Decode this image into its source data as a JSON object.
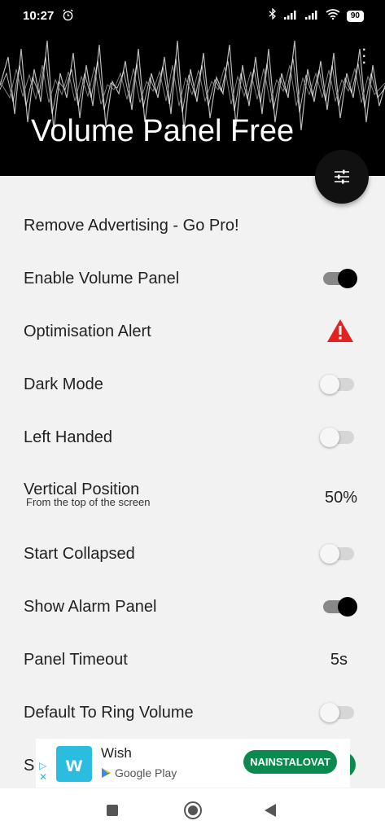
{
  "status": {
    "time": "10:27",
    "battery": "90"
  },
  "header": {
    "title": "Volume Panel Free"
  },
  "settings": [
    {
      "label": "Remove Advertising - Go Pro!"
    },
    {
      "label": "Enable Volume Panel",
      "toggle": true
    },
    {
      "label": "Optimisation Alert"
    },
    {
      "label": "Dark Mode",
      "toggle": false
    },
    {
      "label": "Left Handed",
      "toggle": false
    },
    {
      "label": "Vertical Position",
      "sub": "From the top of the screen",
      "value": "50%"
    },
    {
      "label": "Start Collapsed",
      "toggle": false
    },
    {
      "label": "Show Alarm Panel",
      "toggle": true
    },
    {
      "label": "Panel Timeout",
      "value": "5s"
    },
    {
      "label": "Default To Ring Volume",
      "toggle": false
    },
    {
      "label": "S"
    }
  ],
  "ad": {
    "app_name": "Wish",
    "logo_letter": "w",
    "store": "Google Play",
    "install_label": "NAINSTALOVAT"
  },
  "colors": {
    "alert": "#e52222",
    "install": "#0b8a4f",
    "wish": "#2bbde0"
  }
}
